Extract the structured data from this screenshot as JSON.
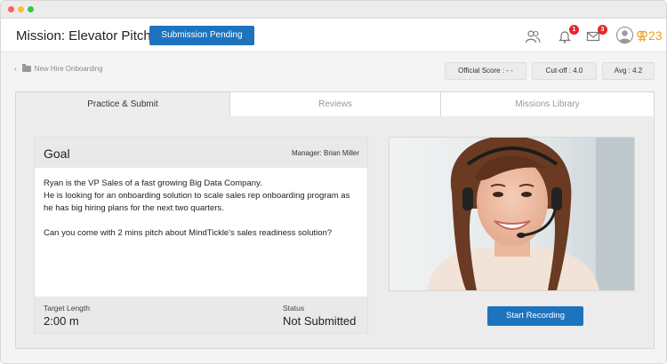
{
  "header": {
    "title": "Mission: Elevator Pitch",
    "submission_button": "Submission Pending",
    "notifications_count": "1",
    "messages_count": "3",
    "points": "⚢23",
    "accent": "#1e73be",
    "badge_color": "#e5272b",
    "points_color": "#f39c12"
  },
  "breadcrumb": {
    "label": "New Hire Onboarding"
  },
  "stats": {
    "official_score": "Official Score : - -",
    "cutoff": "Cut-off : 4.0",
    "avg": "Avg : 4.2"
  },
  "tabs": [
    {
      "label": "Practice & Submit",
      "active": true
    },
    {
      "label": "Reviews",
      "active": false
    },
    {
      "label": "Missions Library",
      "active": false
    }
  ],
  "goal": {
    "title": "Goal",
    "manager": "Manager: Brian Miller",
    "line1": "Ryan is the VP Sales of a fast growing Big Data Company.",
    "line2": "He is looking for an onboarding solution to scale sales rep onboarding program as he has big hiring plans for the next two quarters.",
    "line3": "Can you come with 2 mins pitch about MindTickle's sales readiness solution?",
    "target_length_label": "Target Length",
    "target_length_value": "2:00 m",
    "status_label": "Status",
    "status_value": "Not Submitted"
  },
  "video": {
    "image": "smiling woman wearing headset (photo)"
  },
  "record_button": "Start Recording"
}
